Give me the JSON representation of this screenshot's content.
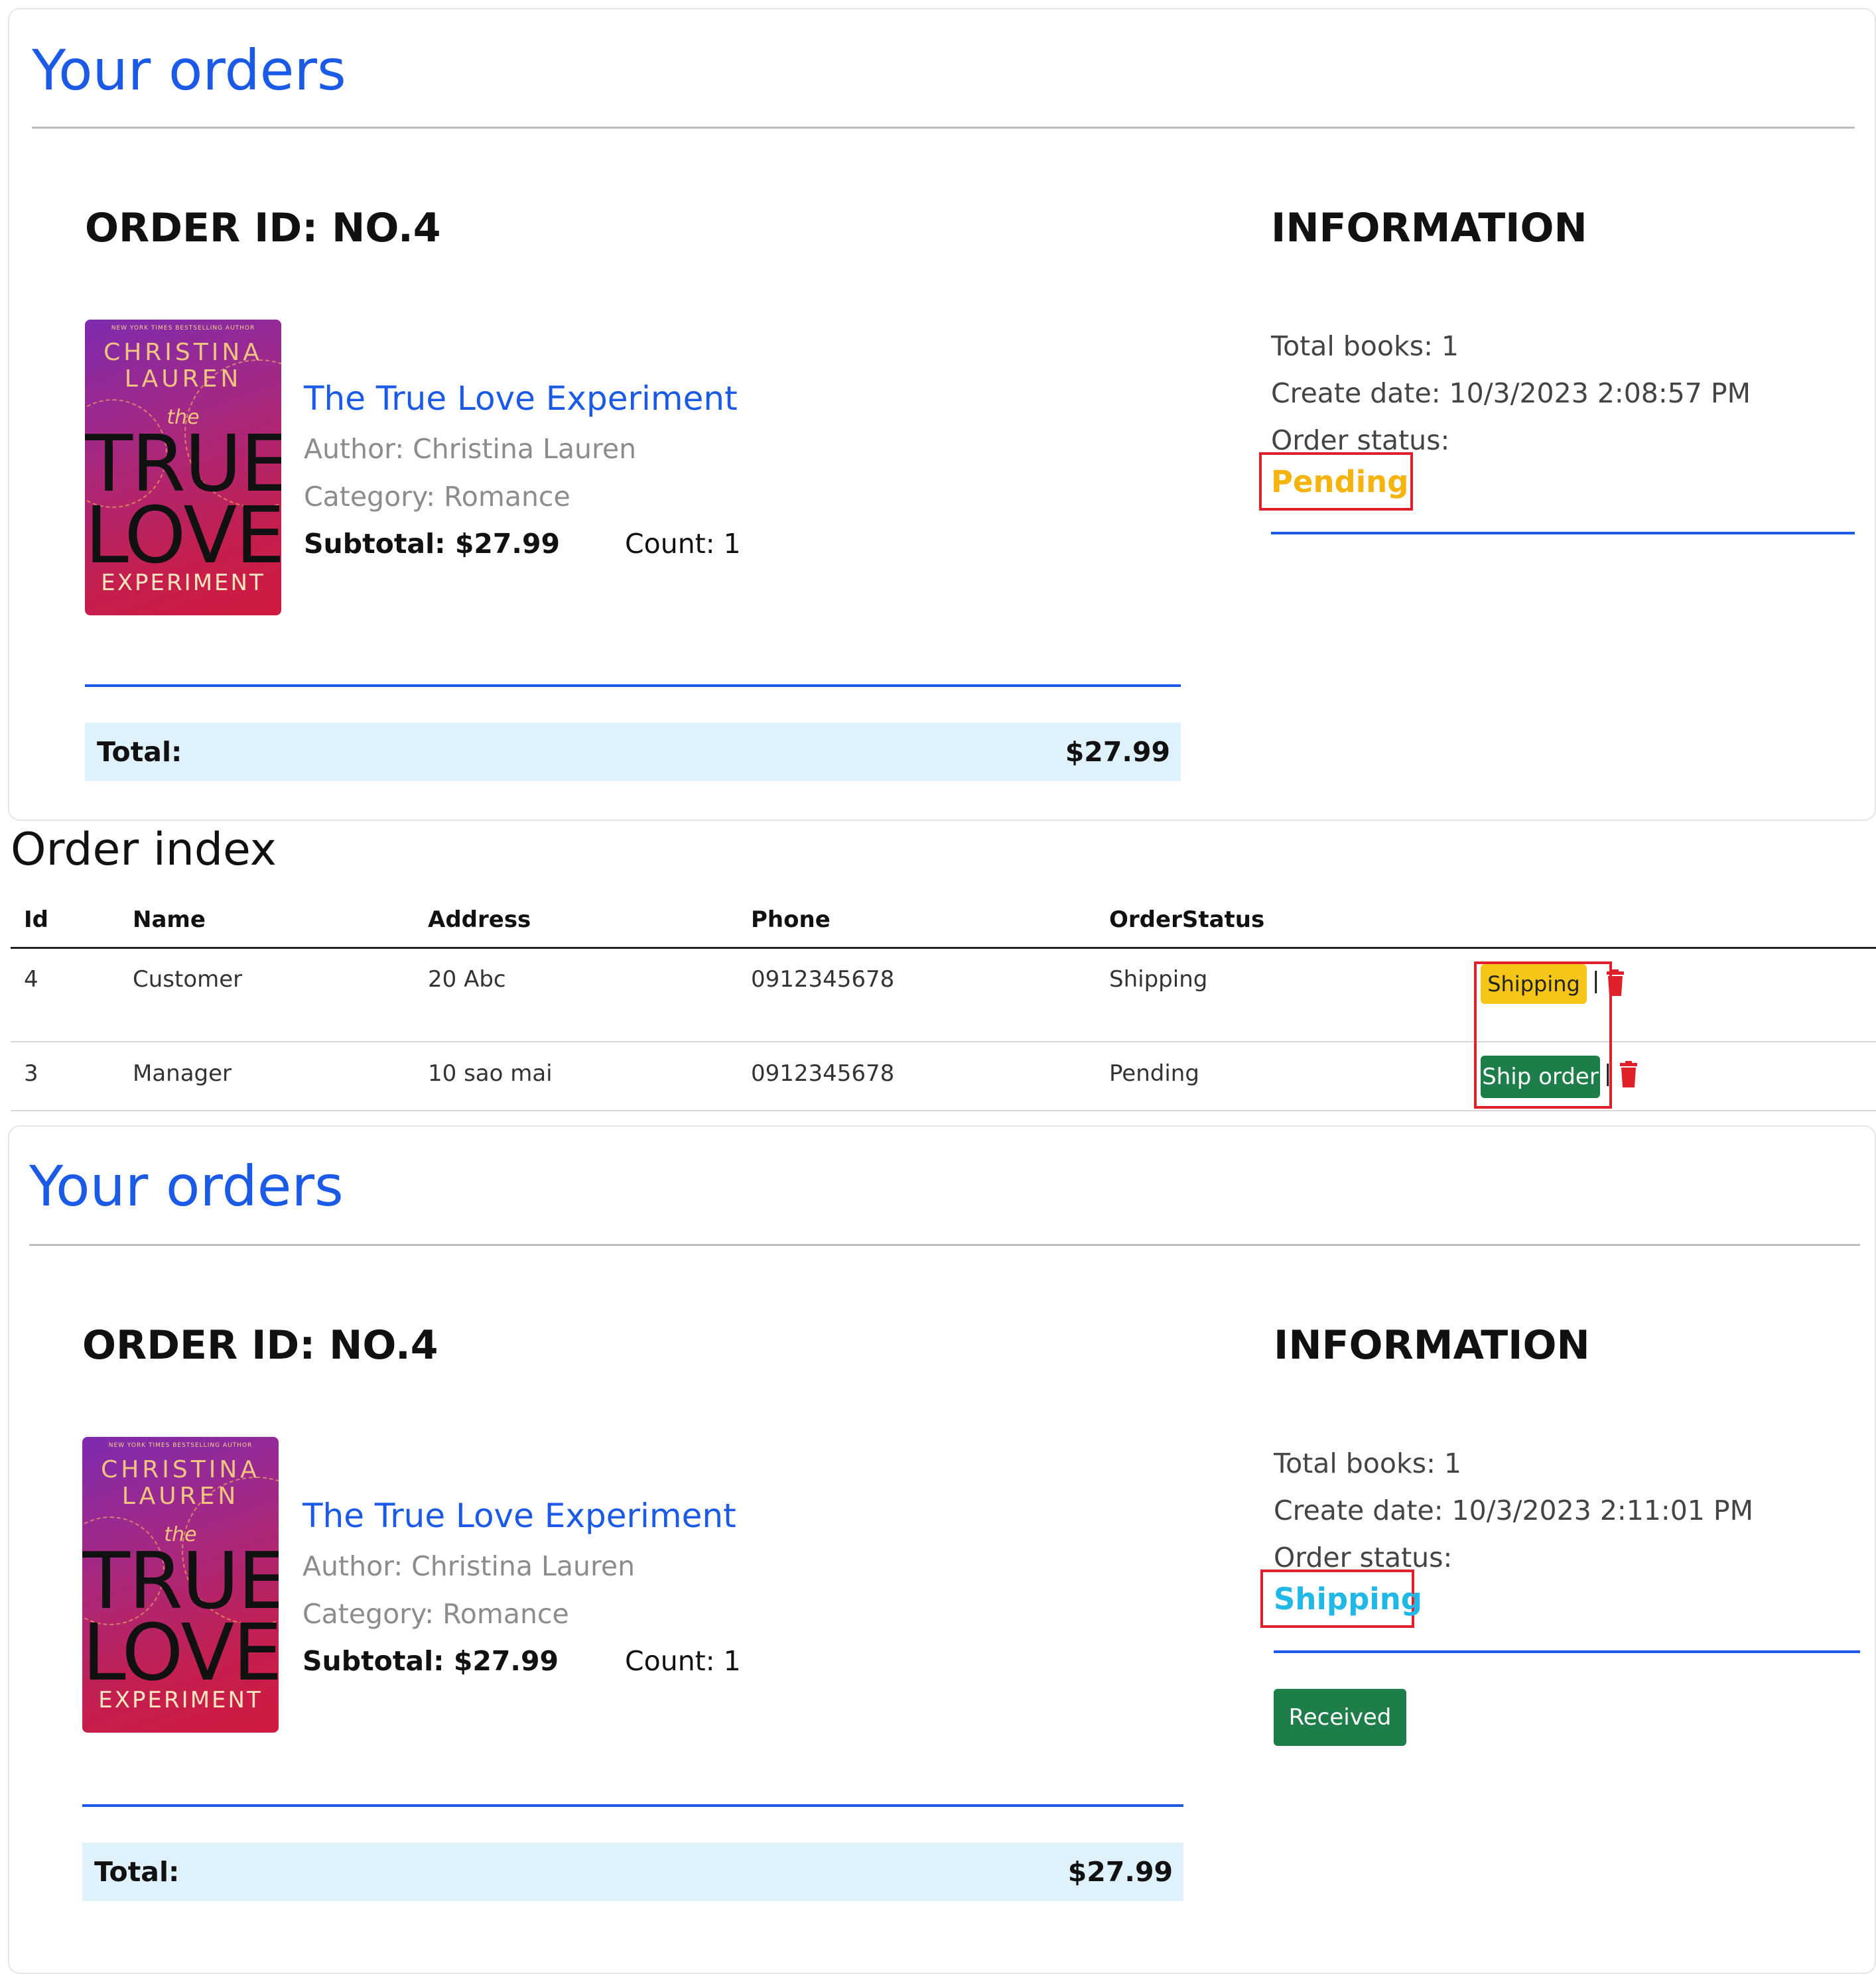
{
  "top_order": {
    "heading": "Your orders",
    "order_id": "ORDER ID: NO.4",
    "book": {
      "cover_small": "NEW YORK TIMES BESTSELLING AUTHOR",
      "cover_author_line1": "CHRISTINA",
      "cover_author_line2": "LAUREN",
      "cover_the": "the",
      "cover_title_line1": "TRUE",
      "cover_title_line2": "LOVE",
      "cover_subtitle": "EXPERIMENT",
      "title": "The True Love Experiment",
      "author": "Author: Christina Lauren",
      "category": "Category: Romance",
      "subtotal": "Subtotal: $27.99",
      "count": "Count: 1"
    },
    "total_label": "Total:",
    "total_value": "$27.99",
    "info_title": "INFORMATION",
    "total_books": "Total books: 1",
    "create_date": "Create date: 10/3/2023 2:08:57 PM",
    "order_status_label": "Order status:",
    "order_status_value": "Pending",
    "status_color": "#f5b40d"
  },
  "order_index": {
    "title": "Order index",
    "columns": [
      "Id",
      "Name",
      "Address",
      "Phone",
      "OrderStatus"
    ],
    "rows": [
      {
        "id": "4",
        "name": "Customer",
        "address": "20 Abc",
        "phone": "0912345678",
        "status": "Shipping",
        "action": "Shipping",
        "separator": "|"
      },
      {
        "id": "3",
        "name": "Manager",
        "address": "10 sao mai",
        "phone": "0912345678",
        "status": "Pending",
        "action": "Ship order",
        "separator": "|"
      }
    ]
  },
  "bottom_order": {
    "heading": "Your orders",
    "order_id": "ORDER ID: NO.4",
    "book": {
      "cover_small": "NEW YORK TIMES BESTSELLING AUTHOR",
      "cover_author_line1": "CHRISTINA",
      "cover_author_line2": "LAUREN",
      "cover_the": "the",
      "cover_title_line1": "TRUE",
      "cover_title_line2": "LOVE",
      "cover_subtitle": "EXPERIMENT",
      "title": "The True Love Experiment",
      "author": "Author: Christina Lauren",
      "category": "Category: Romance",
      "subtotal": "Subtotal: $27.99",
      "count": "Count: 1"
    },
    "total_label": "Total:",
    "total_value": "$27.99",
    "info_title": "INFORMATION",
    "total_books": "Total books: 1",
    "create_date": "Create date: 10/3/2023 2:11:01 PM",
    "order_status_label": "Order status:",
    "order_status_value": "Shipping",
    "status_color": "#22b8e6",
    "received_button": "Received"
  },
  "colors": {
    "accent_blue": "#1a5ae6",
    "highlight_red": "#e0202a",
    "button_green": "#1e7e4a",
    "button_yellow": "#f5c518",
    "trash_red": "#e0202a"
  },
  "icons": [
    "trash-icon"
  ]
}
